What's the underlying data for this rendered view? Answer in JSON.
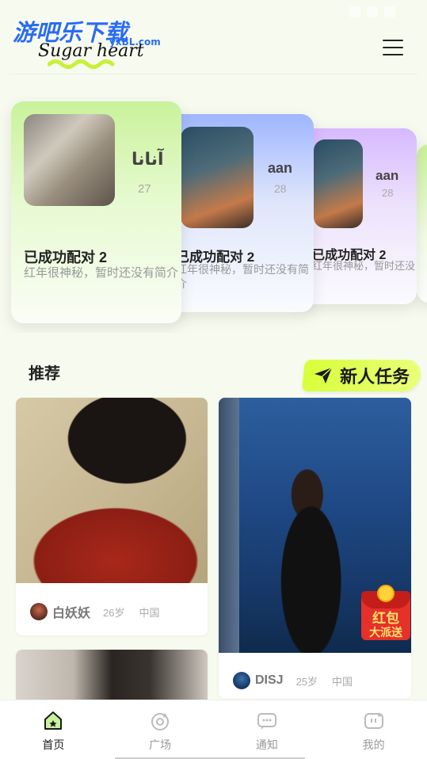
{
  "app": {
    "logo_cn": "游吧乐下载",
    "logo_en": "Sugar heart",
    "logo_domain": "yxBL.com"
  },
  "match_cards": [
    {
      "name": "آنانا",
      "age": "27",
      "title": "已成功配对 2",
      "desc": "红年很神秘，暂时还没有简介"
    },
    {
      "name": "aan",
      "age": "28",
      "title": "已成功配对 2",
      "desc": "红年很神秘，暂时还没有简介"
    },
    {
      "name": "aan",
      "age": "28",
      "title": "已成功配对 2",
      "desc": "红年很神秘，暂时还没有简介"
    }
  ],
  "section": {
    "title": "推荐",
    "task_button": "新人任务"
  },
  "feed": [
    {
      "name": "白妖妖",
      "age": "26岁",
      "location": "中国"
    },
    {
      "name": "DISJ",
      "age": "25岁",
      "location": "中国"
    }
  ],
  "red_packet": {
    "line1": "红包",
    "line2": "大派送"
  },
  "tabs": [
    {
      "label": "首页",
      "icon": "home-icon",
      "active": true
    },
    {
      "label": "广场",
      "icon": "plaza-icon",
      "active": false
    },
    {
      "label": "通知",
      "icon": "message-icon",
      "active": false
    },
    {
      "label": "我的",
      "icon": "profile-icon",
      "active": false
    }
  ],
  "colors": {
    "background": "#f7fbef",
    "accent_green": "#c9f29a",
    "accent_blue": "#9fb6ff",
    "accent_purple": "#d7b9ff",
    "task_yellow": "#d8ff3a",
    "red_packet": "#e6302a"
  }
}
